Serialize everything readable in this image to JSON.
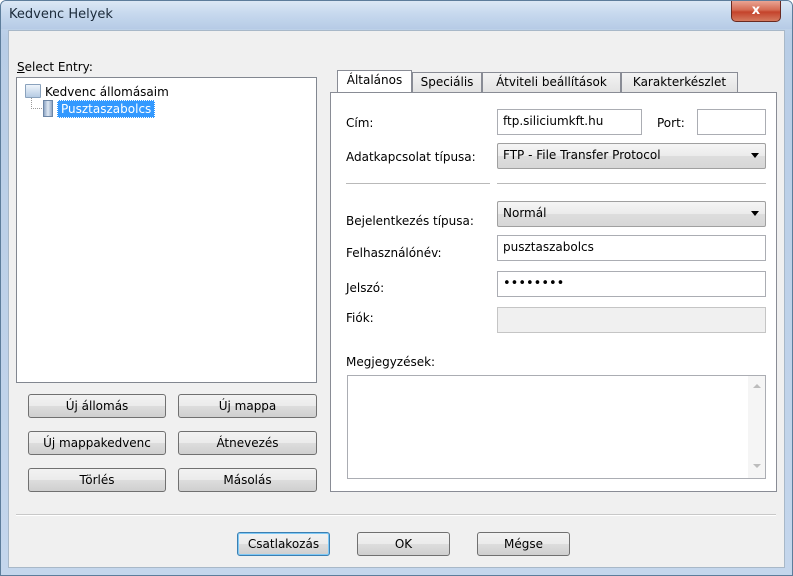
{
  "window": {
    "title": "Kedvenc Helyek",
    "close_glyph": "x"
  },
  "left": {
    "select_label_first": "S",
    "select_label_rest": "elect Entry:",
    "tree": {
      "root": "Kedvenc állomásaim",
      "child": "Pusztaszabolcs"
    },
    "buttons": {
      "new_site": "Új állomás",
      "new_folder": "Új mappa",
      "new_bookmark": "Új mappakedvenc",
      "rename": "Átnevezés",
      "delete": "Törlés",
      "copy": "Másolás"
    }
  },
  "tabs": [
    {
      "label": "Általános"
    },
    {
      "label": "Speciális"
    },
    {
      "label": "Átviteli beállítások"
    },
    {
      "label": "Karakterkészlet"
    }
  ],
  "general": {
    "host_label": "Cím:",
    "host_value": "ftp.siliciumkft.hu",
    "port_label": "Port:",
    "port_value": "",
    "protocol_label": "Adatkapcsolat típusa:",
    "protocol_value": "FTP - File Transfer Protocol",
    "logon_label": "Bejelentkezés típusa:",
    "logon_value": "Normál",
    "user_label": "Felhasználónév:",
    "user_value": "pusztaszabolcs",
    "password_label": "Jelszó:",
    "password_value": "••••••••",
    "account_label": "Fiók:",
    "account_value": "",
    "comments_label": "Megjegyzések:"
  },
  "footer": {
    "connect": "Csatlakozás",
    "ok": "OK",
    "cancel": "Mégse"
  },
  "colors": {
    "selection": "#3399ff",
    "focus_border": "#3c7fb1",
    "close_red": "#c4432b"
  }
}
